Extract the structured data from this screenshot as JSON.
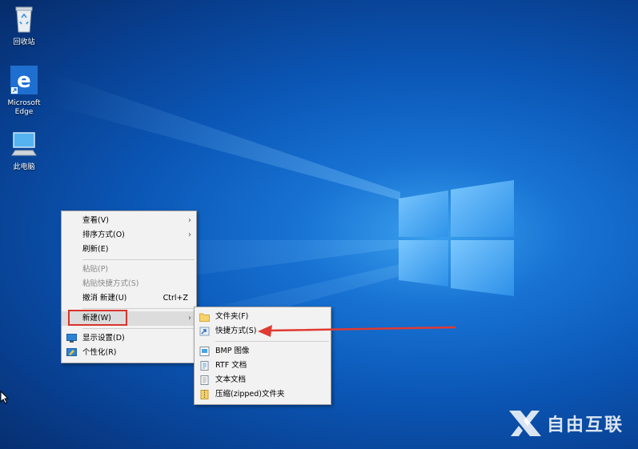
{
  "desktop": {
    "icons": [
      {
        "label": "回收站"
      },
      {
        "label": "Microsoft Edge"
      },
      {
        "label": "此电脑"
      }
    ]
  },
  "context_menu": {
    "view": "查看(V)",
    "sort": "排序方式(O)",
    "refresh": "刷新(E)",
    "paste": "粘贴(P)",
    "paste_shortcut": "粘贴快捷方式(S)",
    "undo": "撤消 新建(U)",
    "undo_shortcut": "Ctrl+Z",
    "new": "新建(W)",
    "display_settings": "显示设置(D)",
    "personalize": "个性化(R)"
  },
  "new_submenu": {
    "folder": "文件夹(F)",
    "shortcut": "快捷方式(S)",
    "bmp": "BMP 图像",
    "rtf": "RTF 文档",
    "txt": "文本文档",
    "zip": "压缩(zipped)文件夹"
  },
  "watermark": {
    "text": "自由互联"
  },
  "colors": {
    "highlight_box": "#d9332b",
    "arrow": "#e03a32",
    "menu_bg": "#f2f2f2"
  }
}
